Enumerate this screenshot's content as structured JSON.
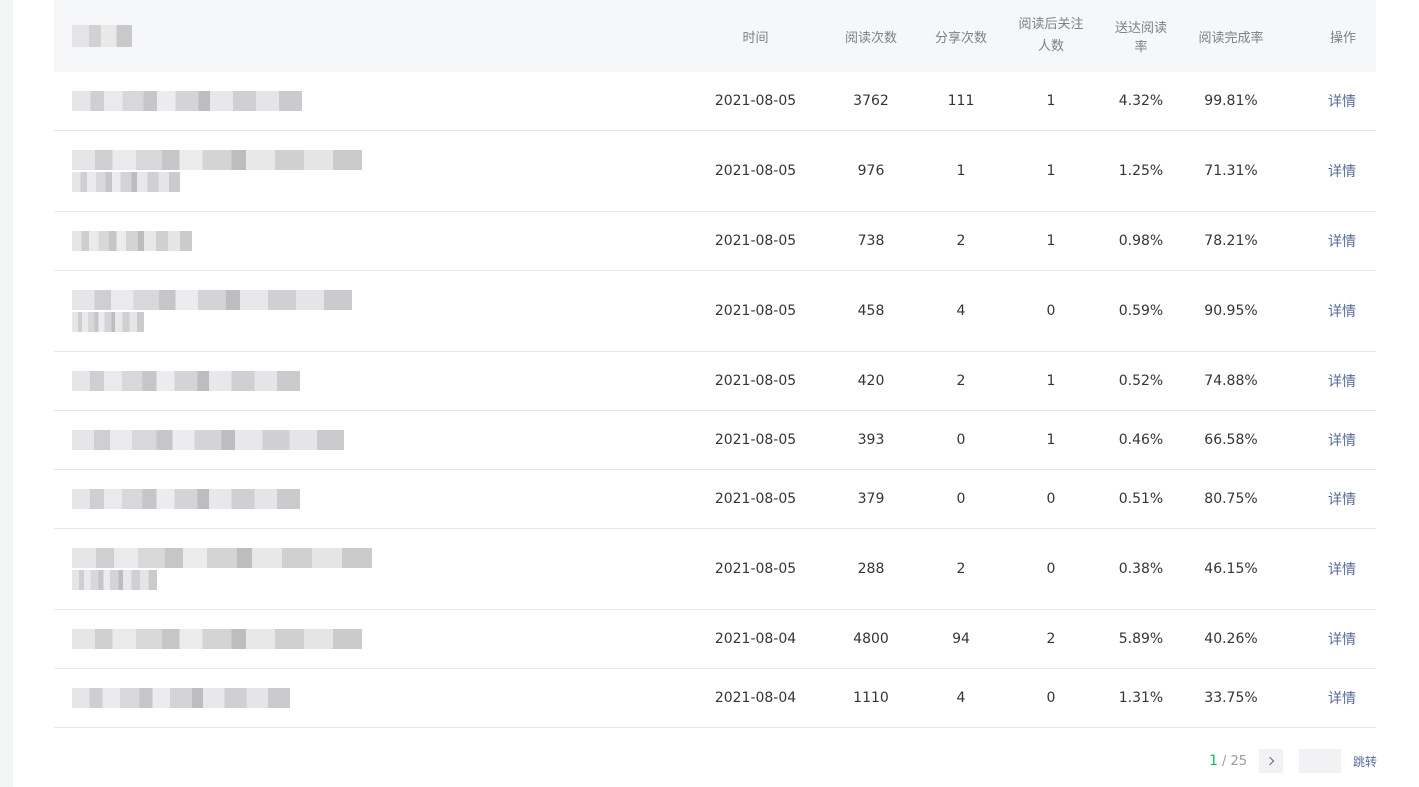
{
  "headers": {
    "time": "时间",
    "reads": "阅读次数",
    "shares": "分享次数",
    "follow_line1": "阅读后关注",
    "follow_line2": "人数",
    "delivery_rate": "送达阅读率",
    "completion_rate": "阅读完成率",
    "action": "操作"
  },
  "rows": [
    {
      "time": "2021-08-05",
      "reads": "3762",
      "shares": "111",
      "follows": "1",
      "delivery_rate": "4.32%",
      "completion_rate": "99.81%",
      "action": "详情"
    },
    {
      "time": "2021-08-05",
      "reads": "976",
      "shares": "1",
      "follows": "1",
      "delivery_rate": "1.25%",
      "completion_rate": "71.31%",
      "action": "详情"
    },
    {
      "time": "2021-08-05",
      "reads": "738",
      "shares": "2",
      "follows": "1",
      "delivery_rate": "0.98%",
      "completion_rate": "78.21%",
      "action": "详情"
    },
    {
      "time": "2021-08-05",
      "reads": "458",
      "shares": "4",
      "follows": "0",
      "delivery_rate": "0.59%",
      "completion_rate": "90.95%",
      "action": "详情"
    },
    {
      "time": "2021-08-05",
      "reads": "420",
      "shares": "2",
      "follows": "1",
      "delivery_rate": "0.52%",
      "completion_rate": "74.88%",
      "action": "详情"
    },
    {
      "time": "2021-08-05",
      "reads": "393",
      "shares": "0",
      "follows": "1",
      "delivery_rate": "0.46%",
      "completion_rate": "66.58%",
      "action": "详情"
    },
    {
      "time": "2021-08-05",
      "reads": "379",
      "shares": "0",
      "follows": "0",
      "delivery_rate": "0.51%",
      "completion_rate": "80.75%",
      "action": "详情"
    },
    {
      "time": "2021-08-05",
      "reads": "288",
      "shares": "2",
      "follows": "0",
      "delivery_rate": "0.38%",
      "completion_rate": "46.15%",
      "action": "详情"
    },
    {
      "time": "2021-08-04",
      "reads": "4800",
      "shares": "94",
      "follows": "2",
      "delivery_rate": "5.89%",
      "completion_rate": "40.26%",
      "action": "详情"
    },
    {
      "time": "2021-08-04",
      "reads": "1110",
      "shares": "4",
      "follows": "0",
      "delivery_rate": "1.31%",
      "completion_rate": "33.75%",
      "action": "详情"
    }
  ],
  "pagination": {
    "current": "1",
    "separator": "/",
    "total": "25",
    "jump_label": "跳转"
  },
  "colors": {
    "accent_green": "#07c160",
    "link_blue": "#576b95",
    "header_bg": "#f6f7f9"
  }
}
